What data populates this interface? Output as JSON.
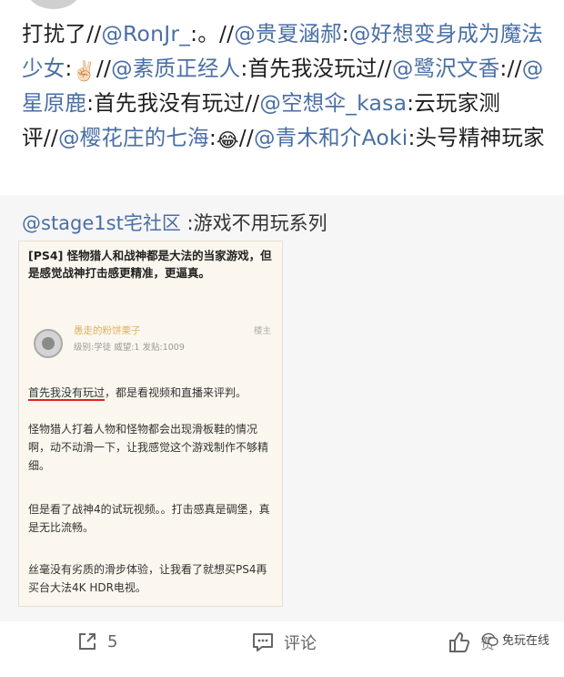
{
  "post": {
    "t1": "打扰了//",
    "m1": "@RonJr_",
    "t2": ":。//",
    "m2": "@贵夏涵郝",
    "t3": ":",
    "m3": "@好想变身成为魔法少女",
    "t4": ":",
    "e1": "✌🏻",
    "t5": "//",
    "m4": "@素质正经人",
    "t6": ":首先我没玩过//",
    "m5": "@鹭沢文香",
    "t7": "://",
    "m6": "@星原鹿",
    "t8": ":首先我没有玩过//",
    "m7": "@空想伞_kasa",
    "t9": ":云玩家测评//",
    "m8": "@樱花庄的七海",
    "t10": ":",
    "e2": "😂",
    "t11": "//",
    "m9": "@青木和介Aoki",
    "t12": ":头号精神玩家"
  },
  "repost": {
    "author": "@stage1st宅社区",
    "text": " :游戏不用玩系列",
    "image": {
      "title": "[PS4] 怪物猎人和战神都是大法的当家游戏，但是感觉战神打击感更精准，更逼真。",
      "username": "愚走的粉饼栗子",
      "meta": "级别:学徒  威望:1  发贴:1009",
      "floor": "楼主",
      "p1_underlined": "首先我没有玩过",
      "p1_rest": "，都是看视频和直播来评判。",
      "p2": "怪物猎人打着人物和怪物都会出现滑板鞋的情况啊，动不动滑一下，让我感觉这个游戏制作不够精细。",
      "p3": "但是看了战神4的试玩视频。。打击感真是碉堡，真是无比流畅。",
      "p4": "丝毫没有劣质的滑步体验，让我看了就想买PS4再买台大法4K HDR电视。"
    }
  },
  "actions": {
    "repost_count": "5",
    "comment_label": "评论",
    "like_label": "赞"
  },
  "watermark": {
    "text": "免玩在线"
  },
  "colors": {
    "mention": "#4a6fa5",
    "repost_bg": "#f6f6f6",
    "underline": "#d22222"
  }
}
